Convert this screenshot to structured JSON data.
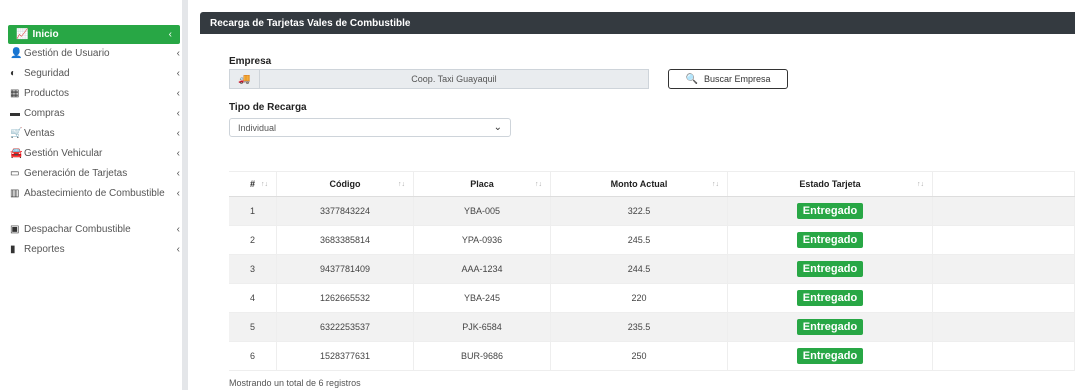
{
  "sidebar": {
    "active": {
      "label": "Inicio",
      "icon": "chart-line-icon"
    },
    "items": [
      {
        "label": "Gestión de Usuario",
        "icon": "user-icon"
      },
      {
        "label": "Seguridad",
        "icon": "shield-icon"
      },
      {
        "label": "Productos",
        "icon": "products-icon"
      },
      {
        "label": "Compras",
        "icon": "truck-icon"
      },
      {
        "label": "Ventas",
        "icon": "cart-icon"
      },
      {
        "label": "Gestión Vehicular",
        "icon": "car-icon"
      },
      {
        "label": "Generación de Tarjetas",
        "icon": "card-icon"
      },
      {
        "label": "Abastecimiento de Combustible",
        "icon": "barcode-icon"
      },
      {
        "label": "Despachar Combustible",
        "icon": "dispatch-icon"
      },
      {
        "label": "Reportes",
        "icon": "bar-chart-icon"
      }
    ]
  },
  "header": {
    "title": "Recarga de Tarjetas Vales de Combustible"
  },
  "form": {
    "empresa_label": "Empresa",
    "empresa_value": "Coop. Taxi Guayaquil",
    "buscar_label": "Buscar Empresa",
    "tipo_label": "Tipo de Recarga",
    "tipo_value": "Individual"
  },
  "table": {
    "headers": [
      "#",
      "Código",
      "Placa",
      "Monto Actual",
      "Estado Tarjeta",
      ""
    ],
    "rows": [
      {
        "n": "1",
        "codigo": "3377843224",
        "placa": "YBA-005",
        "monto": "322.5",
        "estado": "Entregado"
      },
      {
        "n": "2",
        "codigo": "3683385814",
        "placa": "YPA-0936",
        "monto": "245.5",
        "estado": "Entregado"
      },
      {
        "n": "3",
        "codigo": "9437781409",
        "placa": "AAA-1234",
        "monto": "244.5",
        "estado": "Entregado"
      },
      {
        "n": "4",
        "codigo": "1262665532",
        "placa": "YBA-245",
        "monto": "220",
        "estado": "Entregado"
      },
      {
        "n": "5",
        "codigo": "6322253537",
        "placa": "PJK-6584",
        "monto": "235.5",
        "estado": "Entregado"
      },
      {
        "n": "6",
        "codigo": "1528377631",
        "placa": "BUR-9686",
        "monto": "250",
        "estado": "Entregado"
      }
    ],
    "footer": "Mostrando un total de 6 registros"
  },
  "colors": {
    "accent": "#28a745",
    "header_bg": "#343a40"
  }
}
